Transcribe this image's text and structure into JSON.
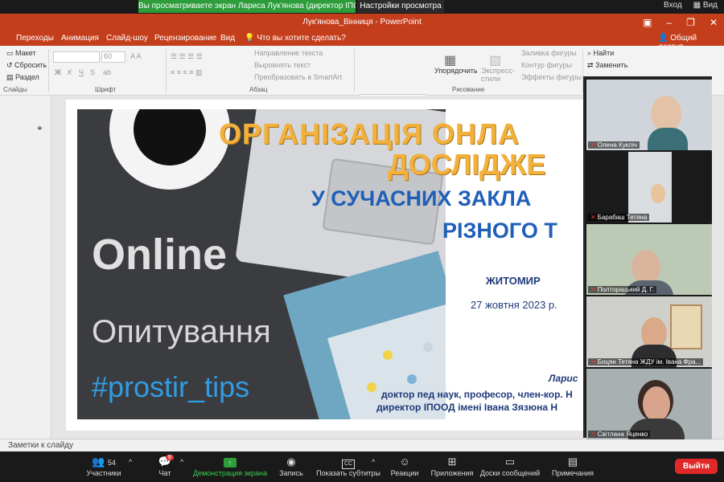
{
  "zoom": {
    "share_banner": "Вы просматриваете экран Лариса Лук'янова (директор ІПОО...",
    "view_settings": "Настройки просмотра",
    "signin": "Вход",
    "view": "Вид"
  },
  "ppt": {
    "title": "Лук'янова_Вінниця - PowerPoint",
    "tabs": [
      "Переходы",
      "Анимация",
      "Слайд-шоу",
      "Рецензирование",
      "Вид"
    ],
    "tell_me": "Что вы хотите сделать?",
    "share": "Общий доступ",
    "ribbon": {
      "layout": "Макет",
      "reset": "Сбросить",
      "section": "Раздел",
      "slides_label": "Слайды",
      "font_label": "Шрифт",
      "font_size": "60",
      "paragraph_label": "Абзац",
      "text_direction": "Направление текста",
      "align_text": "Выровнять текст",
      "smartart": "Преобразовать в SmartArt",
      "arrange": "Упорядочить",
      "quick_styles": "Экспресс-стили",
      "shape_fill": "Заливка фигуры",
      "shape_outline": "Контур фигуры",
      "shape_effects": "Эффекты фигуры",
      "drawing_label": "Рисование",
      "find": "Найти",
      "replace": "Заменить"
    },
    "notes": "Заметки к слайду"
  },
  "slide": {
    "title_line1": "ОРГАНІЗАЦІЯ ОНЛА",
    "title_line2": "ДОСЛІДЖЕ",
    "sub_line1": "У СУЧАСНИХ ЗАКЛА",
    "sub_line2": "РІЗНОГО Т",
    "city": "ЖИТОМИР",
    "date": "27 жовтня 2023 р.",
    "author": "Ларис",
    "cred1": "доктор пед наук, професор, член-кор. Н",
    "cred2": "директор  ІПООД імені Івана Зязюна Н",
    "image_text_online": "Online",
    "image_text_opit": "Опитування",
    "image_text_tag": "#prostir_tips"
  },
  "participants": [
    {
      "name": "Олена Кукліч"
    },
    {
      "name": "Барабаш Тетяна"
    },
    {
      "name": "Полторацький Д. Г."
    },
    {
      "name": "Боцян Тетяна ЖДУ ім. Івана Фра..."
    },
    {
      "name": "Світлана Яценко"
    }
  ],
  "toolbar": {
    "participants_count": "54",
    "participants": "Участники",
    "chat": "Чат",
    "chat_badge": "8",
    "share_screen": "Демонстрация экрана",
    "record": "Запись",
    "subtitles": "Показать субтитры",
    "reactions": "Реакции",
    "apps": "Приложения",
    "whiteboard": "Доски сообщений",
    "notes": "Примечания",
    "leave": "Выйти"
  },
  "colors": {
    "ppt_accent": "#c43e1c",
    "share_green": "#2d9c3a",
    "leave_red": "#e02828",
    "title_orange": "#f3b13b",
    "sub_blue": "#1f5fb8"
  }
}
